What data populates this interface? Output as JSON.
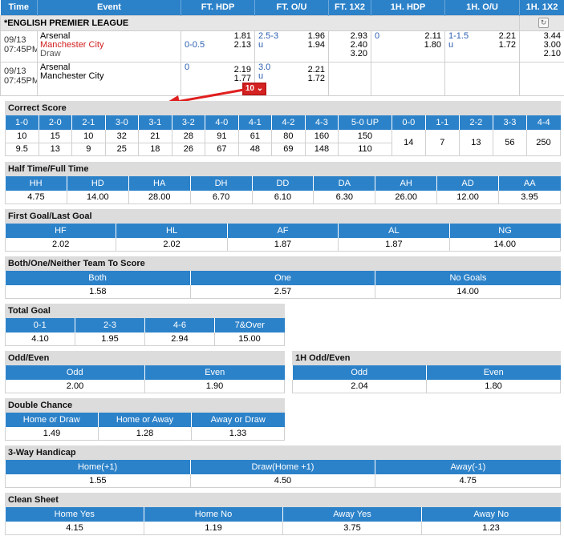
{
  "header": {
    "time": "Time",
    "event": "Event",
    "ft_hdp": "FT. HDP",
    "ft_ou": "FT. O/U",
    "ft_1x2": "FT. 1X2",
    "h1_hdp": "1H. HDP",
    "h1_ou": "1H. O/U",
    "h1_1x2": "1H. 1X2"
  },
  "league": {
    "name": "*ENGLISH PREMIER LEAGUE",
    "refresh_icon": "refresh-icon"
  },
  "matches": [
    {
      "date": "09/13",
      "time": "07:45PM",
      "home": "Arsenal",
      "away": "Manchester City",
      "draw": "Draw",
      "ft_hdp": {
        "line": "0-0.5",
        "home": "1.81",
        "away": "2.13"
      },
      "ft_ou": {
        "line": "2.5-3",
        "under": "u",
        "over_odds": "1.96",
        "under_odds": "1.94"
      },
      "ft_1x2": {
        "home": "2.93",
        "away": "2.40",
        "draw": "3.20"
      },
      "h1_hdp": {
        "line": "0",
        "home": "2.11",
        "away": "1.80"
      },
      "h1_ou": {
        "line": "1-1.5",
        "under": "u",
        "over_odds": "2.21",
        "under_odds": "1.72"
      },
      "h1_1x2": {
        "home": "3.44",
        "away": "3.00",
        "draw": "2.10"
      }
    },
    {
      "date": "09/13",
      "time": "07:45PM",
      "home": "Arsenal",
      "away": "Manchester City",
      "ft_hdp": {
        "line": "0",
        "home": "2.19",
        "away": "1.77"
      },
      "ft_ou": {
        "line": "3.0",
        "under": "u",
        "over_odds": "2.21",
        "under_odds": "1.72"
      },
      "more_markets": "10 ⌄"
    }
  ],
  "correct_score": {
    "title": "Correct Score",
    "headers": [
      "1-0",
      "2-0",
      "2-1",
      "3-0",
      "3-1",
      "3-2",
      "4-0",
      "4-1",
      "4-2",
      "4-3",
      "5-0 UP",
      "0-0",
      "1-1",
      "2-2",
      "3-3",
      "4-4"
    ],
    "row1": [
      "10",
      "15",
      "10",
      "32",
      "21",
      "28",
      "91",
      "61",
      "80",
      "160",
      "150"
    ],
    "row2": [
      "9.5",
      "13",
      "9",
      "25",
      "18",
      "26",
      "67",
      "48",
      "69",
      "148",
      "110"
    ],
    "draws": [
      "14",
      "7",
      "13",
      "56",
      "250"
    ]
  },
  "half_full": {
    "title": "Half Time/Full Time",
    "headers": [
      "HH",
      "HD",
      "HA",
      "DH",
      "DD",
      "DA",
      "AH",
      "AD",
      "AA"
    ],
    "values": [
      "4.75",
      "14.00",
      "28.00",
      "6.70",
      "6.10",
      "6.30",
      "26.00",
      "12.00",
      "3.95"
    ]
  },
  "first_last": {
    "title": "First Goal/Last Goal",
    "headers": [
      "HF",
      "HL",
      "AF",
      "AL",
      "NG"
    ],
    "values": [
      "2.02",
      "2.02",
      "1.87",
      "1.87",
      "14.00"
    ]
  },
  "both_score": {
    "title": "Both/One/Neither Team To Score",
    "headers": [
      "Both",
      "One",
      "No Goals"
    ],
    "values": [
      "1.58",
      "2.57",
      "14.00"
    ]
  },
  "total_goal": {
    "title": "Total Goal",
    "headers": [
      "0-1",
      "2-3",
      "4-6",
      "7&Over"
    ],
    "values": [
      "4.10",
      "1.95",
      "2.94",
      "15.00"
    ]
  },
  "odd_even": {
    "title": "Odd/Even",
    "headers": [
      "Odd",
      "Even"
    ],
    "values": [
      "2.00",
      "1.90"
    ]
  },
  "h1_odd_even": {
    "title": "1H Odd/Even",
    "headers": [
      "Odd",
      "Even"
    ],
    "values": [
      "2.04",
      "1.80"
    ]
  },
  "double_chance": {
    "title": "Double Chance",
    "headers": [
      "Home or Draw",
      "Home or Away",
      "Away or Draw"
    ],
    "values": [
      "1.49",
      "1.28",
      "1.33"
    ]
  },
  "three_way": {
    "title": "3-Way Handicap",
    "headers": [
      "Home(+1)",
      "Draw(Home +1)",
      "Away(-1)"
    ],
    "values": [
      "1.55",
      "4.50",
      "4.75"
    ]
  },
  "clean_sheet": {
    "title": "Clean Sheet",
    "headers": [
      "Home Yes",
      "Home No",
      "Away Yes",
      "Away No"
    ],
    "values": [
      "4.15",
      "1.19",
      "3.75",
      "1.23"
    ]
  },
  "colors": {
    "header_blue": "#2c82c9",
    "away_red": "#d21d1d",
    "badge_red": "#d42222",
    "line_blue": "#2a5db0"
  }
}
